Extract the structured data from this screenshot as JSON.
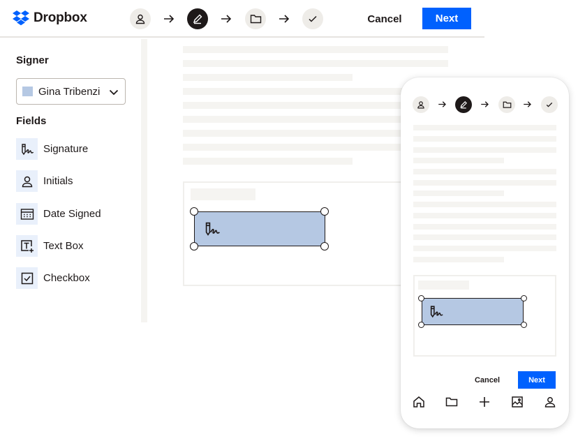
{
  "brand": {
    "name": "Dropbox",
    "color": "#0061fe"
  },
  "header": {
    "steps": [
      "user-icon",
      "pen-icon",
      "folder-icon",
      "check-icon"
    ],
    "active_step": "pen-icon",
    "cancel_label": "Cancel",
    "next_label": "Next"
  },
  "sidebar": {
    "signer_heading": "Signer",
    "signer_value": "Gina Tribenzi",
    "signer_color": "#b5c8e3",
    "fields_heading": "Fields",
    "fields": [
      {
        "label": "Signature",
        "icon": "signature-icon"
      },
      {
        "label": "Initials",
        "icon": "person-icon"
      },
      {
        "label": "Date Signed",
        "icon": "calendar-icon"
      },
      {
        "label": "Text Box",
        "icon": "text-box-icon"
      },
      {
        "label": "Checkbox",
        "icon": "checkbox-icon"
      }
    ]
  },
  "mobile": {
    "cancel_label": "Cancel",
    "next_label": "Next",
    "nav": [
      "home-icon",
      "folder-icon",
      "plus-icon",
      "photo-icon",
      "person-icon"
    ]
  },
  "colors": {
    "accent": "#0061fe",
    "signature_field": "#b5c8e3",
    "placeholder_line": "#f5f4f1",
    "active_step": "#1e1919"
  }
}
